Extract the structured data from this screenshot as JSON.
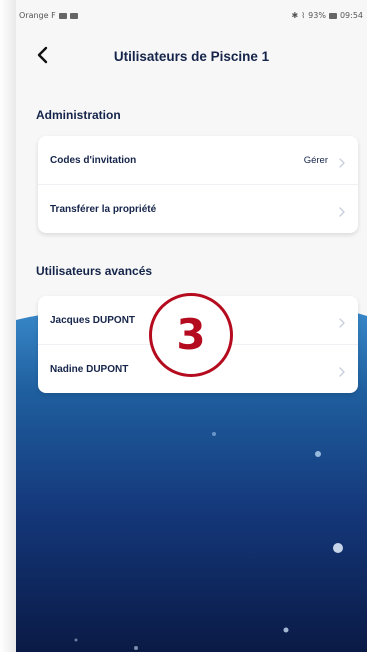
{
  "statusbar": {
    "carrier": "Orange F",
    "battery": "93%",
    "time": "09:54"
  },
  "header": {
    "title": "Utilisateurs de Piscine 1",
    "back_icon": "chevron-left-icon"
  },
  "sections": [
    {
      "title": "Administration",
      "rows": [
        {
          "label": "Codes d'invitation",
          "value": "Gérer"
        },
        {
          "label": "Transférer la propriété",
          "value": ""
        }
      ]
    },
    {
      "title": "Utilisateurs avancés",
      "rows": [
        {
          "label": "Jacques DUPONT",
          "value": ""
        },
        {
          "label": "Nadine DUPONT",
          "value": ""
        }
      ]
    }
  ],
  "annotation": {
    "number": "3",
    "color": "#b50b1e"
  },
  "colors": {
    "text": "#15244a",
    "background": "#f7f7f7",
    "ocean_top": "#2f7fc1",
    "ocean_bottom": "#0b1e4f"
  }
}
